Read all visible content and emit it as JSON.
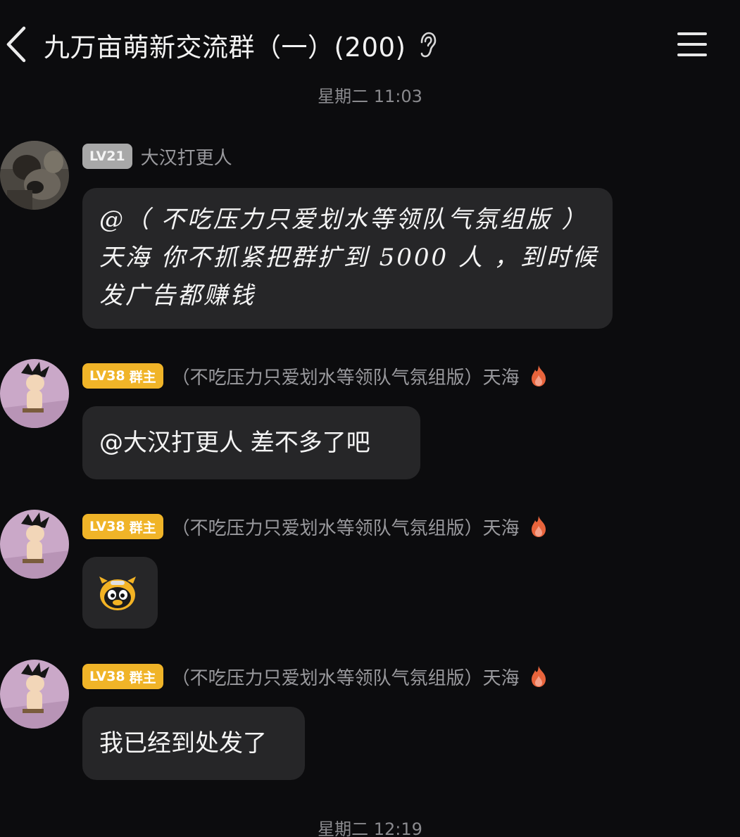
{
  "header": {
    "back_icon": "chevron-left-icon",
    "title": "九万亩萌新交流群（一）(200)",
    "ear_icon": "ear-icon",
    "menu_icon": "menu-icon"
  },
  "timestamps": {
    "first": "星期二 11:03",
    "second": "星期二 12:19"
  },
  "messages": [
    {
      "level": "LV21",
      "role": "",
      "sender": "大汉打更人",
      "text": "@（ 不吃压力只爱划水等领队气氛组版 ）天海 你不抓紧把群扩到 5000 人 ，到时候发广告都赚钱",
      "avatar": "photo-avatar"
    },
    {
      "level": "LV38",
      "role": "群主",
      "sender": "（不吃压力只爱划水等领队气氛组版）天海",
      "text": "@大汉打更人 差不多了吧",
      "avatar": "cartoon-avatar"
    },
    {
      "level": "LV38",
      "role": "群主",
      "sender": "（不吃压力只爱划水等领队气氛组版）天海",
      "text": "",
      "sticker": "penguin-ox-emoji",
      "avatar": "cartoon-avatar"
    },
    {
      "level": "LV38",
      "role": "群主",
      "sender": "（不吃压力只爱划水等领队气氛组版）天海",
      "text": "我已经到处发了",
      "avatar": "cartoon-avatar"
    }
  ],
  "colors": {
    "background": "#0c0c0e",
    "bubble": "#262628",
    "owner_badge": "#f0b428",
    "level_badge_grey": "#a8a8a8",
    "muted_text": "#9a9a9e",
    "flame": "#e8643c"
  }
}
